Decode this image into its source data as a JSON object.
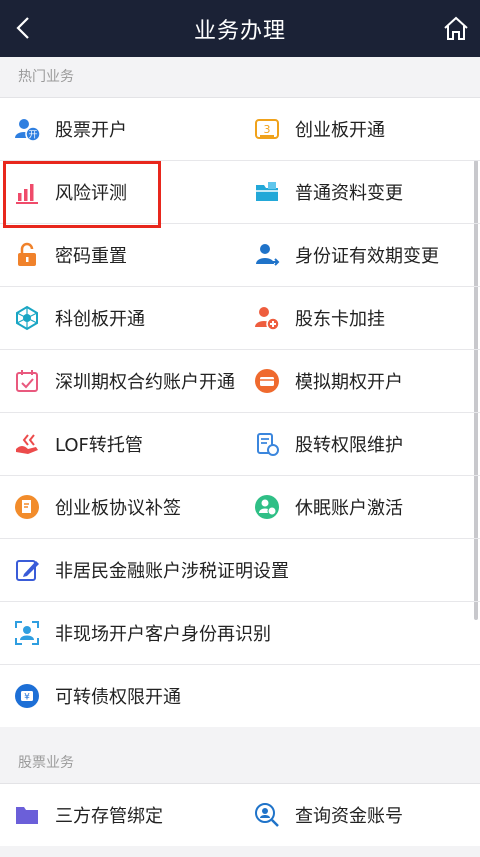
{
  "header": {
    "title": "业务办理"
  },
  "sections": {
    "hot": "热门业务",
    "stock": "股票业务"
  },
  "items": {
    "r1a": "股票开户",
    "r1b": "创业板开通",
    "r2a": "风险评测",
    "r2b": "普通资料变更",
    "r3a": "密码重置",
    "r3b": "身份证有效期变更",
    "r4a": "科创板开通",
    "r4b": "股东卡加挂",
    "r5a": "深圳期权合约账户开通",
    "r5b": "模拟期权开户",
    "r6a": "LOF转托管",
    "r6b": "股转权限维护",
    "r7a": "创业板协议补签",
    "r7b": "休眠账户激活",
    "r8": "非居民金融账户涉税证明设置",
    "r9": "非现场开户客户身份再识别",
    "r10": "可转债权限开通",
    "s1a": "三方存管绑定",
    "s1b": "查询资金账号"
  },
  "colors": {
    "header_bg": "#1b2236",
    "highlight": "#e8271d",
    "accent_blue": "#1d6fd6"
  }
}
